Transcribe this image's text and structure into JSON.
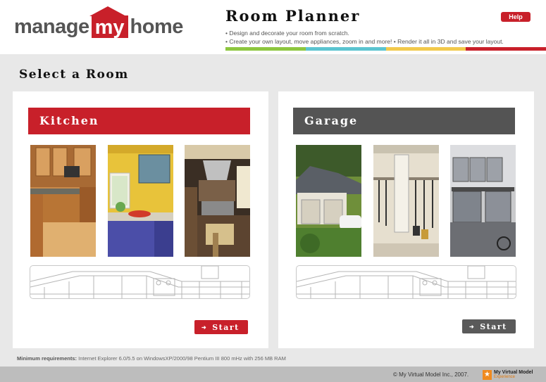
{
  "header": {
    "logo": {
      "part1": "manage",
      "part2": "my",
      "part3": "home"
    },
    "title": "Room Planner",
    "help_label": "Help",
    "description_lines": [
      "• Design and decorate your room from scratch.",
      "• Create your own layout, move appliances, zoom in and more!  • Render it all in 3D and save your layout."
    ],
    "color_bar": [
      "#8dc63f",
      "#5bc4d0",
      "#f2c94c",
      "#c8202a"
    ]
  },
  "page": {
    "section_title": "Select a Room"
  },
  "rooms": [
    {
      "title": "Kitchen",
      "start_label": "Start",
      "accent": "#c8202a"
    },
    {
      "title": "Garage",
      "start_label": "Start",
      "accent": "#545454"
    }
  ],
  "footer": {
    "requirements_label": "Minimum requirements:",
    "requirements_text": "Internet Explorer 6.0/5.5 on WindowsXP/2000/98 Pentium III 800 mHz with 256 MB RAM",
    "copyright": "© My Virtual Model Inc., 2007.",
    "brand_name": "My Virtual Model",
    "brand_tag": "Experience"
  },
  "icons": {
    "start_arrow": "arrow-right-icon",
    "brand_logo": "star-icon"
  }
}
